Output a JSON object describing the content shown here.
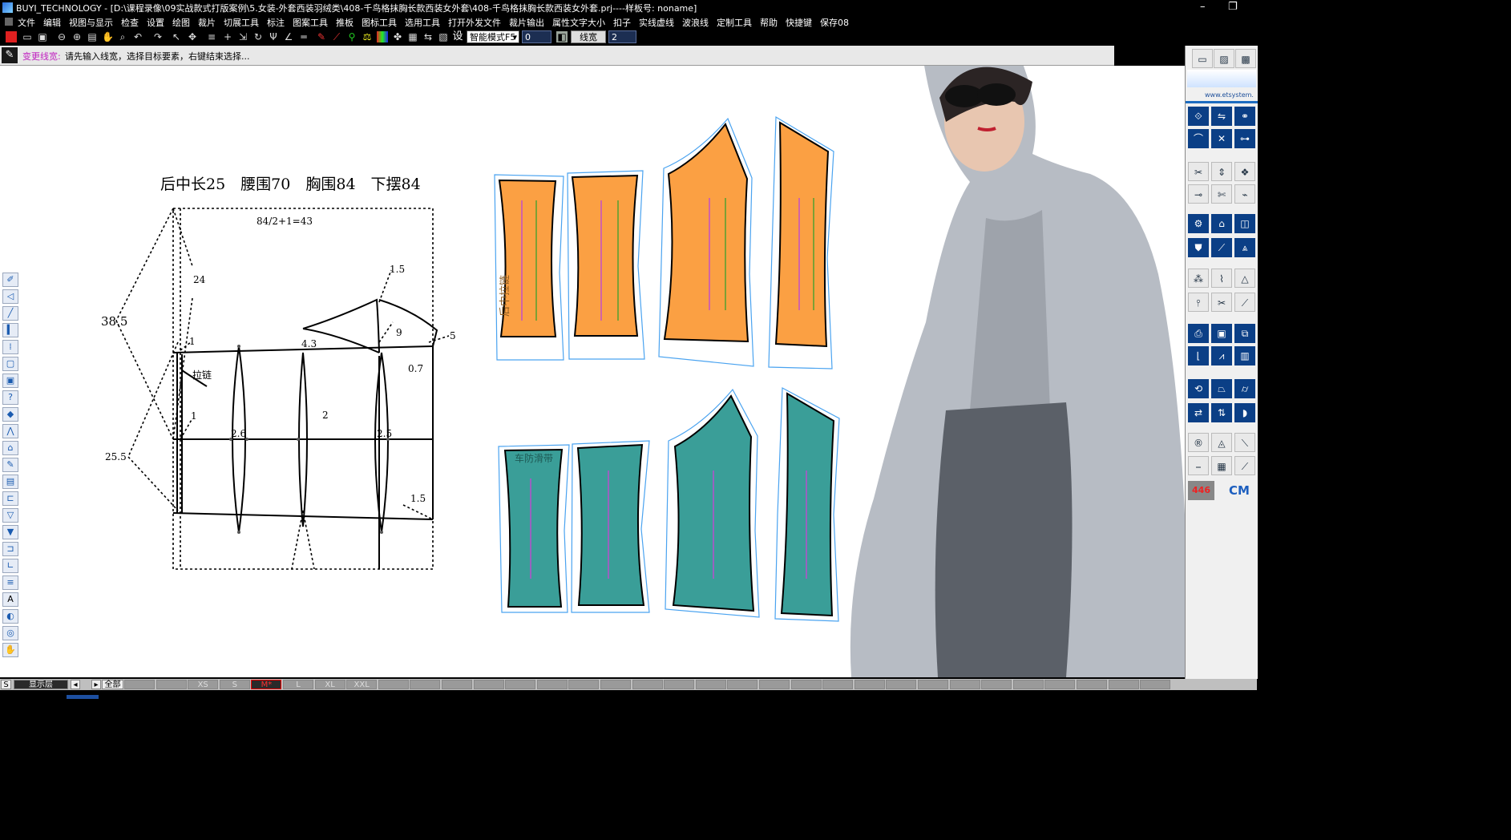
{
  "window": {
    "title": "BUYI_TECHNOLOGY - [D:\\课程录像\\09实战款式打版案例\\5.女装-外套西装羽绒类\\408-千鸟格抹胸长款西装女外套\\408-千鸟格抹胸长款西装女外套.prj----样板号: noname]",
    "minimize": "–",
    "restore": "❐"
  },
  "menu": [
    "文件",
    "编辑",
    "视图与显示",
    "检查",
    "设置",
    "绘图",
    "裁片",
    "切展工具",
    "标注",
    "图案工具",
    "推板",
    "图标工具",
    "选用工具",
    "打开外发文件",
    "裁片输出",
    "属性文字大小",
    "扣子",
    "实线虚线",
    "波浪线",
    "定制工具",
    "帮助",
    "快捷键",
    "保存08"
  ],
  "toolbar": {
    "set_label": "设",
    "mode_select": "智能模式F5",
    "value_field": "0",
    "line_width_label": "线宽",
    "line_width_value": "2"
  },
  "prompt": {
    "title": "变更线宽:",
    "text": "请先输入线宽，选择目标要素，右键结束选择..."
  },
  "drafting": {
    "measurements": "后中长25　腰围70　胸围84　下摆84",
    "formula": "84/2+1=43",
    "labels": {
      "l38_5": "38.5",
      "l24": "24",
      "l25_5": "25.5",
      "l1_top": "1",
      "l1_mid": "1",
      "zipper": "拉链",
      "l4_3": "4.3",
      "l1_5_top": "1.5",
      "l9": "9",
      "l5": "5",
      "l0_7": "0.7",
      "l2_6": "2.6",
      "l2": "2",
      "l2_5": "2.5",
      "l1_5_bot": "1.5"
    }
  },
  "pieces": {
    "back_center_label": "后中拉链",
    "lining_label": "车防滑带"
  },
  "right_panel": {
    "url": "www.etsystem.",
    "count": "446",
    "unit": "CM"
  },
  "bottom": {
    "s_label": "S",
    "layer_label": "显示层",
    "all_label": "全部",
    "sizes": [
      "XS",
      "S",
      "M*",
      "L",
      "XL",
      "XXL"
    ]
  },
  "colors": {
    "orange": "#fba043",
    "teal": "#3a9e98",
    "outline_blue": "#4aa3f0",
    "grain_magenta": "#c04ad0"
  }
}
